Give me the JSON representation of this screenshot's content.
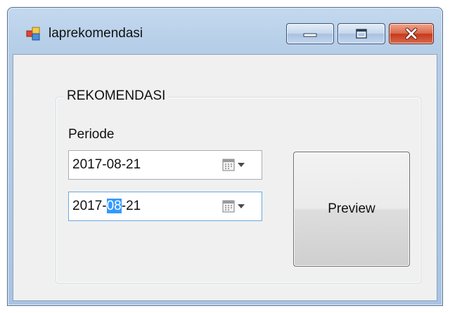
{
  "window": {
    "title": "laprekomendasi"
  },
  "group": {
    "title": "REKOMENDASI",
    "periode_label": "Periode"
  },
  "date_from": {
    "value": "2017-08-21"
  },
  "date_to": {
    "value_before": "2017-",
    "value_selected": "08",
    "value_after": "-21"
  },
  "buttons": {
    "preview_label": "Preview"
  },
  "icons": {
    "app": "app-window-icon",
    "minimize": "minimize-icon",
    "maximize": "maximize-icon",
    "close": "close-icon",
    "calendar": "calendar-icon",
    "dropdown": "dropdown-arrow-icon"
  },
  "colors": {
    "selection": "#3399ff",
    "close_button": "#c6391c",
    "frame": "#b5cde7"
  }
}
